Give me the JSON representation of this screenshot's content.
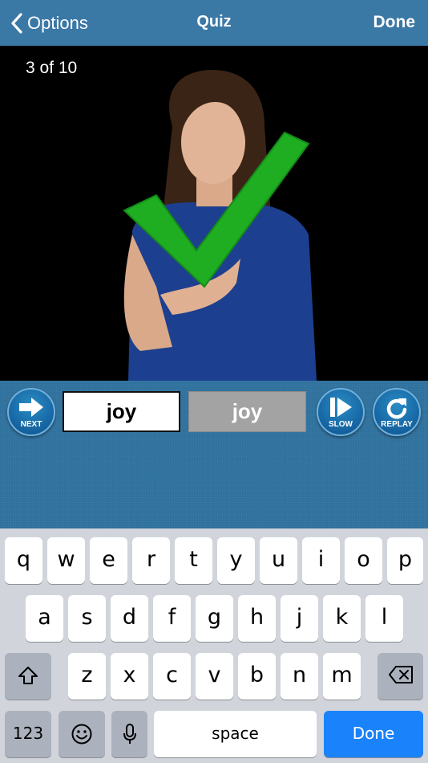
{
  "nav": {
    "back_label": "Options",
    "title": "Quiz",
    "done_label": "Done"
  },
  "video": {
    "counter": "3 of 10"
  },
  "controls": {
    "next_label": "NEXT",
    "answer_value": "joy",
    "correct_answer": "joy",
    "slow_label": "SLOW",
    "replay_label": "REPLAY"
  },
  "keyboard": {
    "row1": [
      "q",
      "w",
      "e",
      "r",
      "t",
      "y",
      "u",
      "i",
      "o",
      "p"
    ],
    "row2": [
      "a",
      "s",
      "d",
      "f",
      "g",
      "h",
      "j",
      "k",
      "l"
    ],
    "row3": [
      "z",
      "x",
      "c",
      "v",
      "b",
      "n",
      "m"
    ],
    "numbers_label": "123",
    "space_label": "space",
    "done_label": "Done"
  },
  "colors": {
    "nav_bar": "#3a78a6",
    "accent_blue": "#1a82fb",
    "check_green": "#1fae22"
  }
}
